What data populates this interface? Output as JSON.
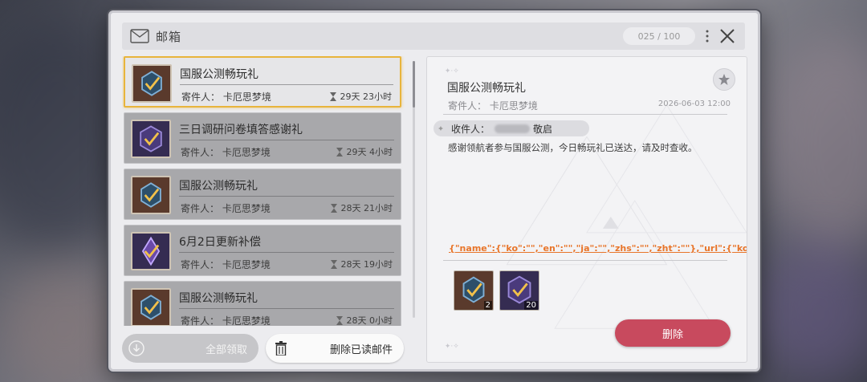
{
  "header": {
    "title": "邮箱",
    "counter": "025 / 100"
  },
  "mail_list": [
    {
      "title": "国服公测畅玩礼",
      "sender": "寄件人：  卡厄思梦境",
      "time": "29天 23小时",
      "icon": "orange-gem-token",
      "active": true
    },
    {
      "title": "三日调研问卷填答感谢礼",
      "sender": "寄件人：  卡厄思梦境",
      "time": "29天 4小时",
      "icon": "purple-gem-token",
      "active": false
    },
    {
      "title": "国服公测畅玩礼",
      "sender": "寄件人：  卡厄思梦境",
      "time": "28天 21小时",
      "icon": "orange-gem-token",
      "active": false
    },
    {
      "title": "6月2日更新补偿",
      "sender": "寄件人：  卡厄思梦境",
      "time": "28天 19小时",
      "icon": "purple-crystal-token",
      "active": false
    },
    {
      "title": "国服公测畅玩礼",
      "sender": "寄件人：  卡厄思梦境",
      "time": "28天 0小时",
      "icon": "orange-gem-token",
      "active": false
    }
  ],
  "actions": {
    "claim_all": "全部领取",
    "delete_read": "删除已读邮件"
  },
  "detail": {
    "title": "国服公测畅玩礼",
    "sender": "寄件人：  卡厄思梦境",
    "date": "2026-06-03 12:00",
    "recipient_label": "收件人：",
    "recipient_suffix": "敬启",
    "body": "感谢领航者参与国服公测，今日畅玩礼已送达，请及时查收。",
    "link_text": "{\"name\":{\"ko\":\"\",\"en\":\"\",\"ja\":\"\",\"zhs\":\"\",\"zht\":\"\"},\"url\":{\"ko\":\"\",\"en\":\"\",\"ja\":\"\",\"zhs\":\"\",\"",
    "rewards": [
      {
        "icon": "orange-gem-token",
        "count": "2"
      },
      {
        "icon": "purple-gem-token",
        "count": "20"
      }
    ],
    "delete_label": "删除"
  },
  "colors": {
    "active_border": "#e8b43c",
    "delete_button": "#c84a5e",
    "link": "#e8752a"
  }
}
